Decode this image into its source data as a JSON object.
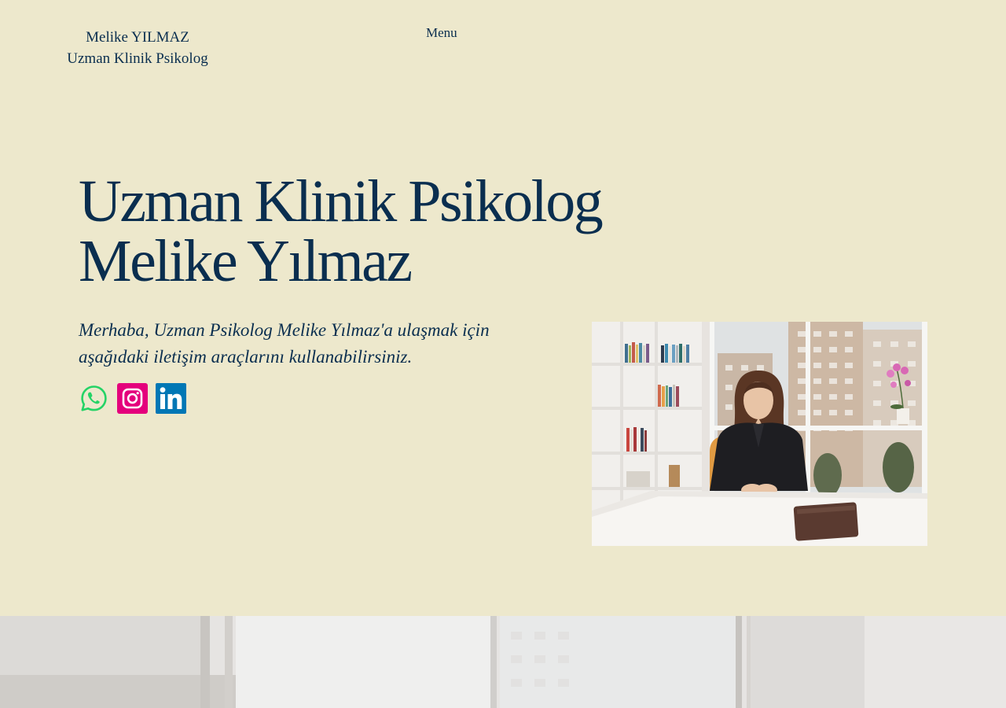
{
  "header": {
    "site_name_line1": "Melike YILMAZ",
    "site_name_line2": "Uzman Klinik Psikolog",
    "menu_label": "Menu"
  },
  "hero": {
    "title_line1": "Uzman Klinik Psikolog",
    "title_line2": "Melike Yılmaz",
    "intro_line1": "Merhaba,  Uzman Psikolog Melike Yılmaz'a ulaşmak için",
    "intro_line2": "aşağıdaki iletişim araçlarını kullanabilirsiniz."
  },
  "social": [
    {
      "name": "whatsapp-icon",
      "color": "#25d366"
    },
    {
      "name": "instagram-icon",
      "color": "#e4007c"
    },
    {
      "name": "linkedin-icon",
      "color": "#0077b5"
    }
  ],
  "colors": {
    "background": "#ede8cc",
    "text": "#0a2e4f"
  }
}
